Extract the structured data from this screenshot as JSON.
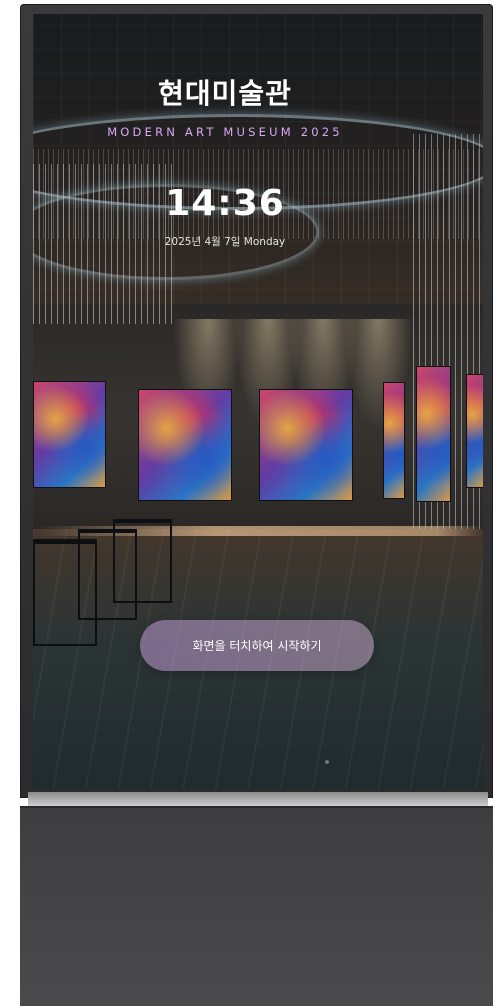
{
  "kiosk": {
    "title": "현대미술관",
    "subtitle": "MODERN ART MUSEUM 2025",
    "time": "14:36",
    "date": "2025년 4월 7일 Monday",
    "start_button_label": "화면을 터치하여 시작하기"
  },
  "colors": {
    "subtitle": "#d9a8f5",
    "button_gradient_start": "#be96d2",
    "button_gradient_end": "#e1bee1",
    "kiosk_body": "#3a3a3c"
  }
}
